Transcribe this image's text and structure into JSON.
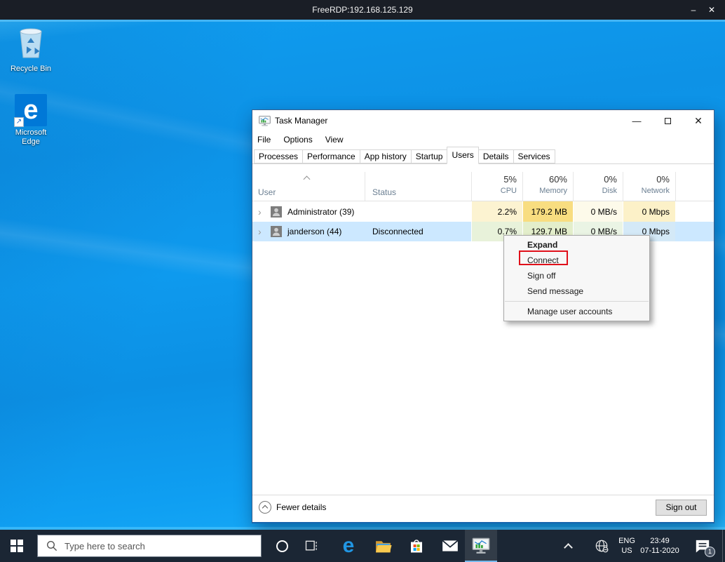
{
  "freerdp": {
    "title": "FreeRDP:192.168.125.129"
  },
  "icons": {
    "rdp_minimize_glyph": "–",
    "rdp_close_glyph": "✕",
    "tm_minimize_glyph": "—",
    "tm_close_glyph": "✕",
    "row_expand_glyph": "›",
    "shortcut_arrow_glyph": "↗",
    "edge_letter": "e"
  },
  "desktop": {
    "recycle_bin_label": "Recycle Bin",
    "edge_label_line1": "Microsoft",
    "edge_label_line2": "Edge"
  },
  "task_manager": {
    "title": "Task Manager",
    "menu": [
      {
        "label": "File"
      },
      {
        "label": "Options"
      },
      {
        "label": "View"
      }
    ],
    "tabs": [
      {
        "label": "Processes"
      },
      {
        "label": "Performance"
      },
      {
        "label": "App history"
      },
      {
        "label": "Startup"
      },
      {
        "label": "Users"
      },
      {
        "label": "Details"
      },
      {
        "label": "Services"
      }
    ],
    "active_tab": "Users",
    "header": {
      "user": "User",
      "status": "Status",
      "cpu_pct": "5%",
      "cpu_label": "CPU",
      "memory_pct": "60%",
      "memory_label": "Memory",
      "disk_pct": "0%",
      "disk_label": "Disk",
      "network_pct": "0%",
      "network_label": "Network"
    },
    "rows": [
      {
        "name": "Administrator (39)",
        "status": "",
        "cpu": "2.2%",
        "memory": "179.2 MB",
        "disk": "0 MB/s",
        "network": "0 Mbps"
      },
      {
        "name": "janderson (44)",
        "status": "Disconnected",
        "cpu": "0.7%",
        "memory": "129.7 MB",
        "disk": "0 MB/s",
        "network": "0 Mbps"
      }
    ],
    "footer": {
      "fewer_details": "Fewer details",
      "sign_out": "Sign out"
    }
  },
  "context_menu": {
    "items": [
      {
        "label": "Expand"
      },
      {
        "label": "Connect"
      },
      {
        "label": "Sign off"
      },
      {
        "label": "Send message"
      },
      {
        "label": "Manage user accounts"
      }
    ],
    "annotated_item": "Connect"
  },
  "taskbar": {
    "search_placeholder": "Type here to search",
    "language_line1": "ENG",
    "language_line2": "US",
    "time": "23:49",
    "date": "07-11-2020",
    "notification_count": "1"
  },
  "colors": {
    "accent": "#0078d7",
    "selection": "#cce8ff",
    "annotation_red": "#e0101a",
    "heat_cpu": "#fcf3d1",
    "heat_memory": "#f8dd80",
    "heat_disk": "#fdfaea",
    "heat_network": "#fcf1c8",
    "taskbar_bg": "#1b2634",
    "rdp_titlebar_bg": "#1a1e26",
    "wallpaper_blue": "#0d93e6"
  }
}
